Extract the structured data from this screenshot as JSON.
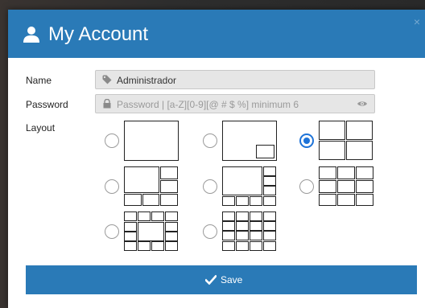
{
  "dialog": {
    "title": "My Account",
    "close_glyph": "×",
    "header_color": "#2a7ab7"
  },
  "form": {
    "name_label": "Name",
    "name_value": "Administrador",
    "name_icon": "tag-icon",
    "password_label": "Password",
    "password_placeholder": "Password | [a-Z][0-9][@ # $ %] minimum 6",
    "password_icon": "lock-icon",
    "password_toggle_icon": "eye-icon",
    "layout_label": "Layout"
  },
  "layouts": {
    "selected": "layout-2x2",
    "options": [
      "layout-single",
      "layout-picture-in-picture",
      "layout-2x2",
      "layout-1-plus-5",
      "layout-1-plus-7",
      "layout-3x3",
      "layout-center-plus-12",
      "layout-4x4"
    ]
  },
  "save": {
    "label": "Save",
    "icon": "checkmark-icon"
  }
}
